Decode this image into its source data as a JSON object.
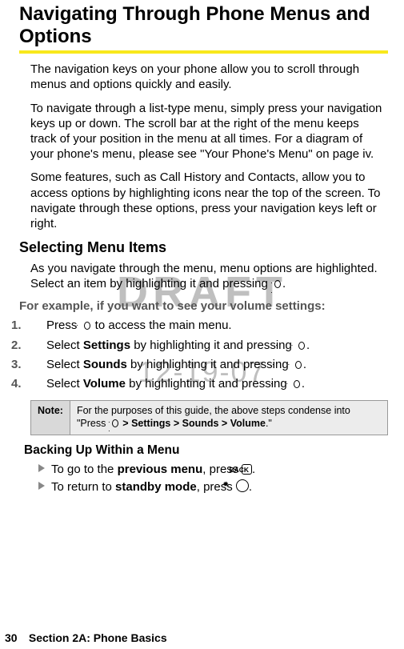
{
  "title": "Navigating Through Phone Menus and Options",
  "watermark": {
    "draft": "DRAFT",
    "date": "12-19-07"
  },
  "paras": {
    "p1": "The navigation keys on your phone allow you to scroll through menus and options quickly and easily.",
    "p2": "To navigate through a list-type menu, simply press your navigation keys up or down. The scroll bar at the right of the menu keeps track of your position in the menu at all times. For a diagram of your phone's menu, please see \"Your Phone's Menu\" on page iv.",
    "p3": "Some features, such as Call History and Contacts, allow you to access options by highlighting icons near the top of the screen. To navigate through these options, press your navigation keys left or right."
  },
  "sub1": "Selecting Menu Items",
  "sel_para_a": "As you navigate through the menu, menu options are highlighted. Select an item by highlighting it and pressing ",
  "sel_para_b": ".",
  "lead": "For example, if you want to see your volume settings:",
  "steps": [
    {
      "n": "1.",
      "before": "Press ",
      "bold": "",
      "mid": " to access the main menu.",
      "icon": "nav"
    },
    {
      "n": "2.",
      "before": "Select ",
      "bold": "Settings",
      "mid": " by highlighting it and pressing ",
      "icon": "nav",
      "after": "."
    },
    {
      "n": "3.",
      "before": "Select ",
      "bold": "Sounds",
      "mid": " by highlighting it and pressing ",
      "icon": "nav",
      "after": "."
    },
    {
      "n": "4.",
      "before": "Select ",
      "bold": "Volume",
      "mid": " by highlighting it and pressing ",
      "icon": "nav",
      "after": "."
    }
  ],
  "note": {
    "label": "Note:",
    "text_a": "For the purposes of this guide, the above steps condense into \"Press ",
    "text_bold": " > Settings > Sounds > Volume",
    "text_b": ".\""
  },
  "sub2": "Backing Up Within a Menu",
  "bullets": [
    {
      "pre": "To go to the ",
      "bold": "previous menu",
      "post": ", press ",
      "btn": "BACK",
      "end": "."
    },
    {
      "pre": "To return to ",
      "bold": "standby mode",
      "post": ", press ",
      "btn": "CIRCLE",
      "end": "."
    }
  ],
  "footer": {
    "page": "30",
    "label": "Section 2A: Phone Basics"
  }
}
